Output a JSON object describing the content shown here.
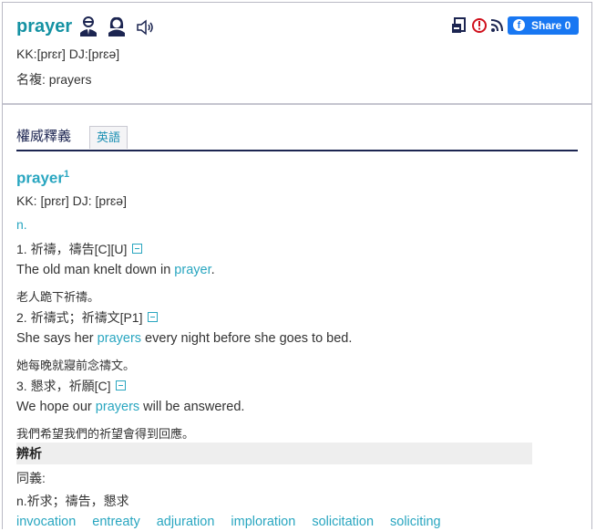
{
  "entry": {
    "word": "prayer",
    "pronunciation": "KK:[prɛr] DJ:[prɛə]",
    "plural": "名複: prayers"
  },
  "share": {
    "label": "Share 0"
  },
  "tabs": {
    "main": "權威釋義",
    "english": "英語"
  },
  "definition": {
    "headword": "prayer",
    "superscript": "1",
    "pronunciation": "KK: [prɛr] DJ: [prɛə]",
    "pos": "n.",
    "senses": [
      {
        "label": "1. 祈禱，禱告[C][U]",
        "en_before": "The old man knelt down in ",
        "en_hl": "prayer",
        "en_after": ".",
        "zh": "老人跪下祈禱。"
      },
      {
        "label": "2. 祈禱式；祈禱文[P1]",
        "en_before": "She says her ",
        "en_hl": "prayers",
        "en_after": " every night before she goes to bed.",
        "zh": "她每晚就寢前念禱文。"
      },
      {
        "label": "3. 懇求，祈願[C]",
        "en_before": "We hope our ",
        "en_hl": "prayers",
        "en_after": " will be answered.",
        "zh": "我們希望我們的祈望會得到回應。"
      }
    ]
  },
  "synonyms": {
    "header": "辨析",
    "label": "同義:",
    "gloss": "n.祈求；禱告，懇求",
    "words": [
      "invocation",
      "entreaty",
      "adjuration",
      "imploration",
      "solicitation",
      "soliciting"
    ]
  },
  "icons": [
    "male-speaker-icon",
    "female-speaker-icon",
    "sound-icon",
    "bookmark-icon",
    "report-icon",
    "rss-icon",
    "facebook-icon",
    "collapse-icon"
  ]
}
